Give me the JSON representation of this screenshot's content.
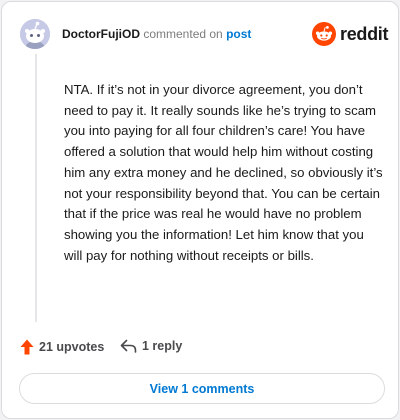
{
  "header": {
    "username": "DoctorFujiOD",
    "action_text": "commented on",
    "post_link": "post"
  },
  "brand": {
    "wordmark": "reddit",
    "color": "#ff4500"
  },
  "comment": {
    "body": "NTA. If it’s not in your divorce agreement, you don’t need to pay it. It really sounds like he’s trying to scam you into paying for all four children’s care! You have offered a solution that would help him without costing him any extra money and he declined, so obviously it’s not your responsibility beyond that. You can be certain that if the price was real he would have no problem showing you the information! Let him know that you will pay for nothing without receipts or bills."
  },
  "actions": {
    "upvotes_label": "21 upvotes",
    "upvote_icon": "upvote-arrow-icon",
    "upvote_color": "#ff4500",
    "reply_label": "1 reply",
    "reply_icon": "reply-arrow-icon"
  },
  "footer": {
    "view_comments_label": "View 1 comments",
    "link_color": "#0079d3"
  }
}
